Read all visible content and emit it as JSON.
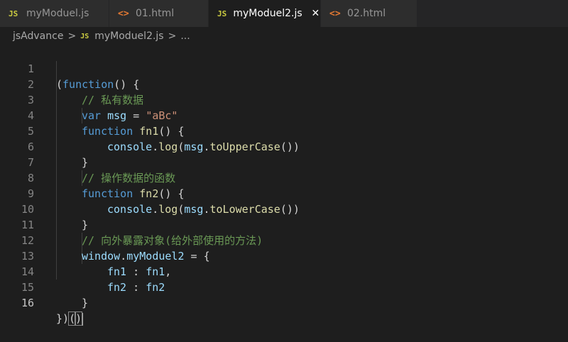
{
  "tabs": [
    {
      "icon": "JS",
      "label": "myModuel.js"
    },
    {
      "icon": "<>",
      "label": "01.html"
    },
    {
      "icon": "JS",
      "label": "myModuel2.js",
      "close": "✕"
    },
    {
      "icon": "<>",
      "label": "02.html"
    }
  ],
  "breadcrumb": {
    "folder": "jsAdvance",
    "sep": ">",
    "icon": "JS",
    "file": "myModuel2.js",
    "ellipsis": "..."
  },
  "lines": [
    {
      "n": "1",
      "t": [
        "(",
        "function",
        "() {"
      ]
    },
    {
      "n": "2",
      "t": [
        "// 私有数据"
      ]
    },
    {
      "n": "3",
      "t": [
        "var",
        " ",
        "msg",
        " = ",
        "\"aBc\""
      ]
    },
    {
      "n": "4",
      "t": [
        "function",
        " ",
        "fn1",
        "() {"
      ]
    },
    {
      "n": "5",
      "t": [
        "console",
        ".",
        "log",
        "(",
        "msg",
        ".",
        "toUpperCase",
        "())"
      ]
    },
    {
      "n": "6",
      "t": [
        "}"
      ]
    },
    {
      "n": "7",
      "t": [
        "// 操作数据的函数"
      ]
    },
    {
      "n": "8",
      "t": [
        "function",
        " ",
        "fn2",
        "() {"
      ]
    },
    {
      "n": "9",
      "t": [
        "console",
        ".",
        "log",
        "(",
        "msg",
        ".",
        "toLowerCase",
        "())"
      ]
    },
    {
      "n": "10",
      "t": [
        "}"
      ]
    },
    {
      "n": "11",
      "t": [
        "// 向外暴露对象(给外部使用的方法)"
      ]
    },
    {
      "n": "12",
      "t": [
        "window",
        ".",
        "myModuel2",
        " = {"
      ]
    },
    {
      "n": "13",
      "t": [
        "fn1",
        " : ",
        "fn1",
        ","
      ]
    },
    {
      "n": "14",
      "t": [
        "fn2",
        " : ",
        "fn2"
      ]
    },
    {
      "n": "15",
      "t": [
        "}"
      ]
    },
    {
      "n": "16",
      "t": [
        "})",
        "(",
        ")"
      ]
    }
  ]
}
